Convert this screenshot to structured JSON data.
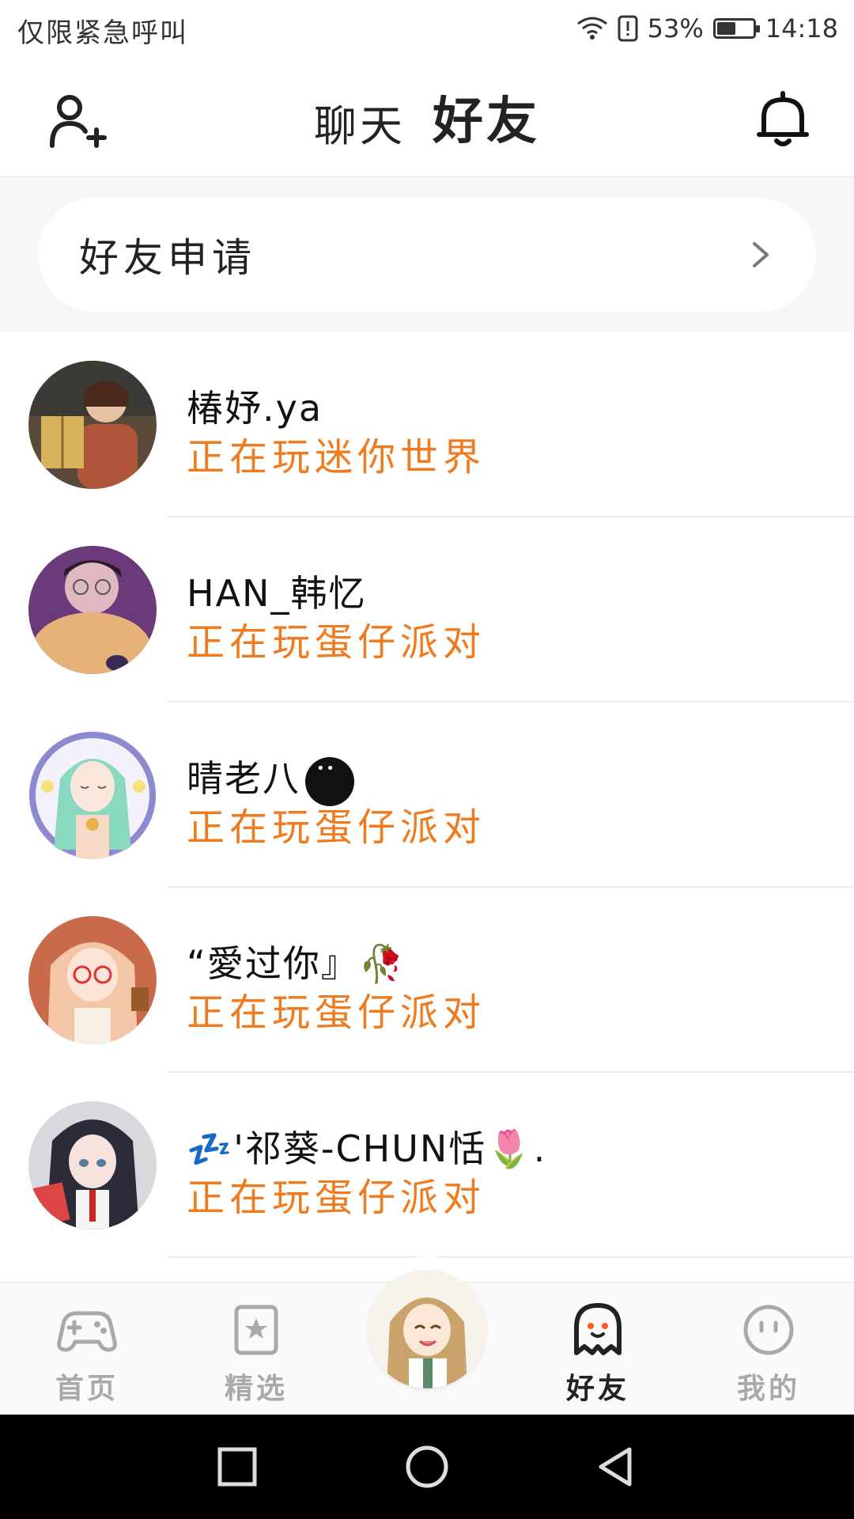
{
  "status_bar": {
    "carrier_text": "仅限紧急呼叫",
    "battery_percent": "53%",
    "battery_level": 0.53,
    "time": "14:18"
  },
  "header": {
    "tabs": [
      {
        "label": "聊天",
        "active": false
      },
      {
        "label": "好友",
        "active": true
      }
    ],
    "left_icon": "add-friend-icon",
    "right_icon": "bell-icon"
  },
  "friend_requests": {
    "label": "好友申请"
  },
  "friends": [
    {
      "name": "椿妤.ya",
      "status": "正在玩迷你世界"
    },
    {
      "name": "HAN_韩忆",
      "status": "正在玩蛋仔派对"
    },
    {
      "name": "晴老八",
      "status": "正在玩蛋仔派对"
    },
    {
      "name": "“愛过你』🥀",
      "status": "正在玩蛋仔派对"
    },
    {
      "name": "💤'祁葵-CHUN恬🌷.",
      "status": "正在玩蛋仔派对"
    }
  ],
  "bottom_nav": {
    "items": [
      {
        "label": "首页",
        "icon": "gamepad-icon"
      },
      {
        "label": "精选",
        "icon": "star-icon"
      },
      {
        "label": "好友",
        "icon": "ghost-icon",
        "active": true
      },
      {
        "label": "我的",
        "icon": "smiley-icon"
      }
    ]
  },
  "colors": {
    "accent": "#ff5a1f",
    "status_text": "#f07a1e",
    "background_section": "#f6f7f9"
  }
}
